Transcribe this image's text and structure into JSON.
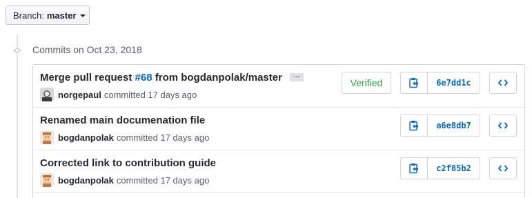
{
  "branch": {
    "prefix": "Branch:",
    "name": "master"
  },
  "timeline": {
    "date_heading": "Commits on Oct 23, 2018"
  },
  "commits": [
    {
      "title_prefix": "Merge pull request ",
      "pr_number": "#68",
      "title_suffix": " from bogdanpolak/master",
      "ellipsis": "…",
      "author": "norgepaul",
      "action": "committed 17 days ago",
      "verified": "Verified",
      "sha": "6e7dd1c"
    },
    {
      "title": "Renamed main documenation file",
      "author": "bogdanpolak",
      "action": "committed 17 days ago",
      "sha": "a6e8db7"
    },
    {
      "title": "Corrected link to contribution guide",
      "author": "bogdanpolak",
      "action": "committed 17 days ago",
      "sha": "c2f85b2"
    }
  ],
  "icons": {
    "branch_caret": "caret-down-icon",
    "timeline": "git-commit-icon",
    "copy": "clippy-icon",
    "browse": "code-icon"
  },
  "colors": {
    "link": "#0366d6",
    "verified": "#28a745",
    "text": "#24292e",
    "muted": "#586069",
    "border": "#d1d5da"
  }
}
